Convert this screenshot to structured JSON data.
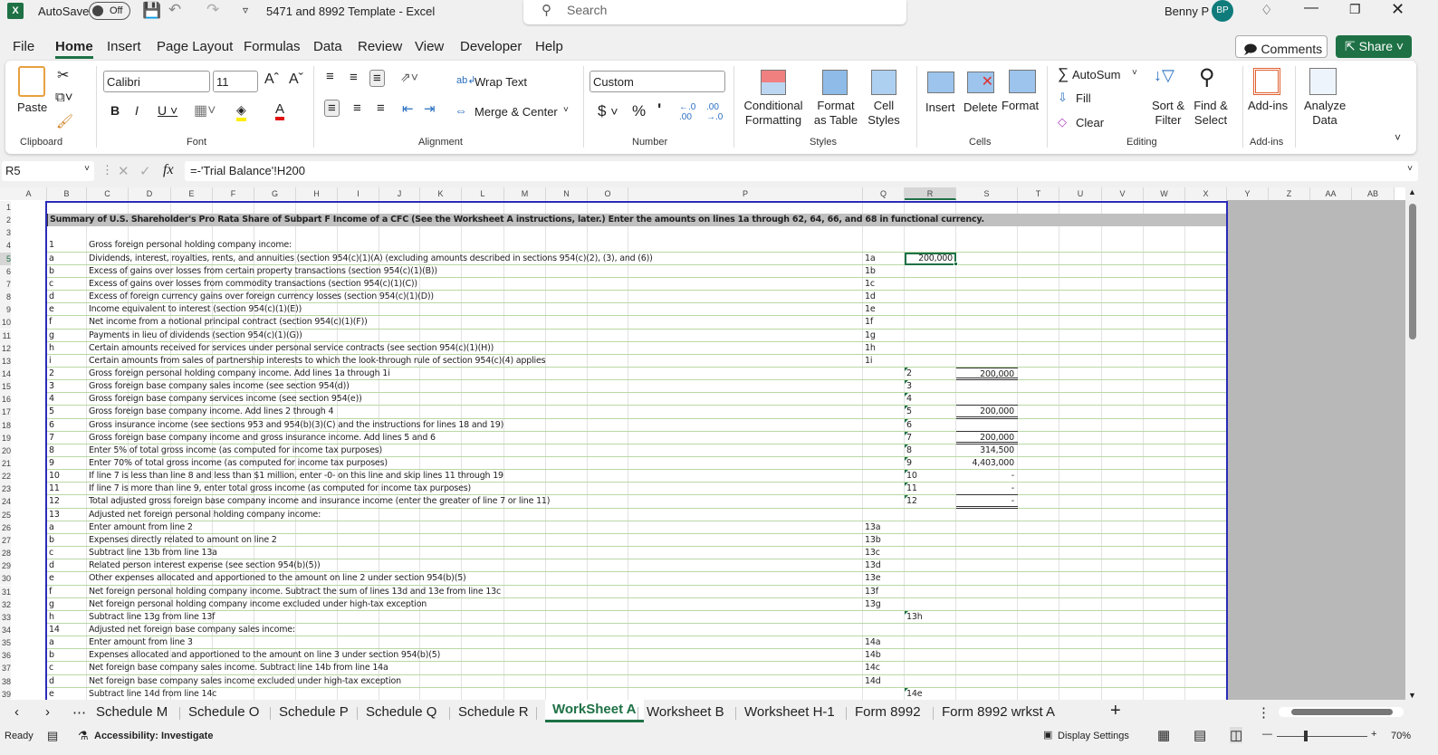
{
  "titlebar": {
    "autosave": "AutoSave",
    "autosave_state": "Off",
    "doc_title": "5471 and 8992 Template  -  Excel",
    "search_placeholder": "Search",
    "user": "Benny P",
    "initials": "BP"
  },
  "menu": [
    "File",
    "Home",
    "Insert",
    "Page Layout",
    "Formulas",
    "Data",
    "Review",
    "View",
    "Developer",
    "Help"
  ],
  "comments": "Comments",
  "share": "Share",
  "ribbon": {
    "paste": "Paste",
    "clipboard": "Clipboard",
    "font_name": "Calibri",
    "font_size": "11",
    "font": "Font",
    "wrap": "Wrap Text",
    "merge": "Merge & Center",
    "alignment": "Alignment",
    "number_format": "Custom",
    "number": "Number",
    "cond": "Conditional Formatting",
    "fmt_table": "Format as Table",
    "cell_styles": "Cell Styles",
    "styles": "Styles",
    "insert": "Insert",
    "delete": "Delete",
    "format": "Format",
    "cells": "Cells",
    "autosum": "AutoSum",
    "fill": "Fill",
    "clear": "Clear",
    "sort": "Sort & Filter",
    "find": "Find & Select",
    "editing": "Editing",
    "addins": "Add-ins",
    "addins_grp": "Add-ins",
    "analyze": "Analyze Data"
  },
  "formula_bar": {
    "name_box": "R5",
    "formula": "=-'Trial Balance'!H200"
  },
  "columns": [
    "A",
    "B",
    "C",
    "D",
    "E",
    "F",
    "G",
    "H",
    "I",
    "J",
    "K",
    "L",
    "M",
    "N",
    "O",
    "P",
    "Q",
    "R",
    "S",
    "T",
    "U",
    "V",
    "W",
    "X",
    "Y",
    "Z",
    "AA",
    "AB"
  ],
  "header_row": "Summary of U.S. Shareholder's Pro Rata Share of Subpart F Income of a CFC (See the Worksheet A instructions, later.) Enter the amounts on lines 1a through 62, 64, 66, and 68 in functional currency.",
  "rows": [
    {
      "n": 1
    },
    {
      "n": 2
    },
    {
      "n": 3
    },
    {
      "n": 4,
      "b": "1",
      "c": "Gross foreign personal holding company income:"
    },
    {
      "n": 5,
      "b": "a",
      "c": "Dividends, interest, royalties, rents, and annuities (section 954(c)(1)(A) (excluding amounts described in sections 954(c)(2), (3), and (6))",
      "q": "1a",
      "r": "200,000"
    },
    {
      "n": 6,
      "b": "b",
      "c": "Excess of gains over losses from certain property transactions (section 954(c)(1)(B))",
      "q": "1b"
    },
    {
      "n": 7,
      "b": "c",
      "c": "Excess of gains over losses from commodity transactions (section 954(c)(1)(C))",
      "q": "1c"
    },
    {
      "n": 8,
      "b": "d",
      "c": "Excess of foreign currency gains over foreign currency losses (section 954(c)(1)(D))",
      "q": "1d"
    },
    {
      "n": 9,
      "b": "e",
      "c": "Income equivalent to interest (section 954(c)(1)(E))",
      "q": "1e"
    },
    {
      "n": 10,
      "b": "f",
      "c": "Net income from a notional principal contract (section 954(c)(1)(F))",
      "q": "1f"
    },
    {
      "n": 11,
      "b": "g",
      "c": "Payments in lieu of dividends (section 954(c)(1)(G))",
      "q": "1g"
    },
    {
      "n": 12,
      "b": "h",
      "c": "Certain amounts received for services under personal service contracts (see section 954(c)(1)(H))",
      "q": "1h"
    },
    {
      "n": 13,
      "b": "i",
      "c": "Certain amounts from sales of partnership interests to which the look-through rule of section 954(c)(4) applies",
      "q": "1i"
    },
    {
      "n": 14,
      "b": "2",
      "c": "Gross foreign personal holding company income. Add lines 1a through 1i",
      "rl": "2",
      "s": "200,000"
    },
    {
      "n": 15,
      "b": "3",
      "c": "Gross foreign base company sales income (see section 954(d))",
      "rl": "3"
    },
    {
      "n": 16,
      "b": "4",
      "c": "Gross foreign base company services income (see section 954(e))",
      "rl": "4"
    },
    {
      "n": 17,
      "b": "5",
      "c": "Gross foreign base company income. Add lines 2 through 4",
      "rl": "5",
      "s": "200,000"
    },
    {
      "n": 18,
      "b": "6",
      "c": "Gross insurance income (see sections 953 and 954(b)(3)(C) and the instructions for lines 18 and 19)",
      "rl": "6"
    },
    {
      "n": 19,
      "b": "7",
      "c": "Gross foreign base company income and gross insurance income. Add lines 5 and 6",
      "rl": "7",
      "s": "200,000"
    },
    {
      "n": 20,
      "b": "8",
      "c": "Enter 5% of total gross income (as computed for income tax purposes)",
      "rl": "8",
      "s": "314,500"
    },
    {
      "n": 21,
      "b": "9",
      "c": "Enter 70% of total gross income (as computed for income tax purposes)",
      "rl": "9",
      "s": "4,403,000"
    },
    {
      "n": 22,
      "b": "10",
      "c": "If line 7 is less than line 8 and less than $1 million, enter -0- on this line and skip lines 11 through 19",
      "rl": "10",
      "s": "-"
    },
    {
      "n": 23,
      "b": "11",
      "c": "If line 7 is more than line 9, enter total gross income (as computed for income tax purposes)",
      "rl": "11",
      "s": "-"
    },
    {
      "n": 24,
      "b": "12",
      "c": "Total adjusted gross foreign base company income and insurance income (enter the greater of line 7 or line 11)",
      "rl": "12",
      "s": "-"
    },
    {
      "n": 25,
      "b": "13",
      "c": "Adjusted net foreign personal holding company income:"
    },
    {
      "n": 26,
      "b": "a",
      "c": "Enter amount from line 2",
      "q": "13a"
    },
    {
      "n": 27,
      "b": "b",
      "c": "Expenses directly related to amount on line 2",
      "q": "13b"
    },
    {
      "n": 28,
      "b": "c",
      "c": "Subtract line 13b from line 13a",
      "q": "13c"
    },
    {
      "n": 29,
      "b": "d",
      "c": "Related person interest expense (see section 954(b)(5))",
      "q": "13d"
    },
    {
      "n": 30,
      "b": "e",
      "c": "Other expenses allocated and apportioned to the amount on line 2 under section 954(b)(5)",
      "q": "13e"
    },
    {
      "n": 31,
      "b": "f",
      "c": "Net foreign personal holding company income. Subtract the sum of lines 13d and 13e from line 13c",
      "q": "13f"
    },
    {
      "n": 32,
      "b": "g",
      "c": "Net foreign personal holding company income excluded under high-tax exception",
      "q": "13g"
    },
    {
      "n": 33,
      "b": "h",
      "c": "Subtract line 13g from line 13f",
      "rl": "13h"
    },
    {
      "n": 34,
      "b": "14",
      "c": "Adjusted net foreign base company sales income:"
    },
    {
      "n": 35,
      "b": "a",
      "c": "Enter amount from line 3",
      "q": "14a"
    },
    {
      "n": 36,
      "b": "b",
      "c": "Expenses allocated and apportioned to the amount on line 3 under section 954(b)(5)",
      "q": "14b"
    },
    {
      "n": 37,
      "b": "c",
      "c": "Net foreign base company sales income. Subtract line 14b from line 14a",
      "q": "14c"
    },
    {
      "n": 38,
      "b": "d",
      "c": "Net foreign base company sales income excluded under high-tax exception",
      "q": "14d"
    },
    {
      "n": 39,
      "b": "e",
      "c": "Subtract line 14d from line 14c",
      "rl": "14e"
    }
  ],
  "sheet_tabs": [
    "Schedule M",
    "Schedule O",
    "Schedule P",
    "Schedule Q",
    "Schedule R",
    "WorkSheet A",
    "Worksheet B",
    "Worksheet H-1",
    "Form 8992",
    "Form 8992 wrkst A"
  ],
  "active_tab": "WorkSheet A",
  "status": {
    "ready": "Ready",
    "accessibility": "Accessibility: Investigate",
    "display": "Display Settings",
    "zoom": "70%"
  },
  "colors": {
    "accent": "#1e7145",
    "grid_green": "#b9d9a4",
    "print_border": "#2b2bb8"
  }
}
